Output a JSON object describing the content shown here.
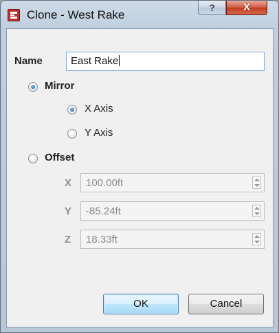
{
  "window": {
    "title": "Clone - West Rake",
    "help_glyph": "?",
    "close_glyph": "X"
  },
  "form": {
    "name_label": "Name",
    "name_value": "East Rake",
    "mirror": {
      "label": "Mirror",
      "checked": true,
      "options": [
        {
          "label": "X Axis",
          "checked": true
        },
        {
          "label": "Y Axis",
          "checked": false
        }
      ]
    },
    "offset": {
      "label": "Offset",
      "checked": false,
      "fields": [
        {
          "axis": "X",
          "value": "100.00ft"
        },
        {
          "axis": "Y",
          "value": "-85.24ft"
        },
        {
          "axis": "Z",
          "value": "18.33ft"
        }
      ]
    }
  },
  "buttons": {
    "ok": "OK",
    "cancel": "Cancel"
  }
}
